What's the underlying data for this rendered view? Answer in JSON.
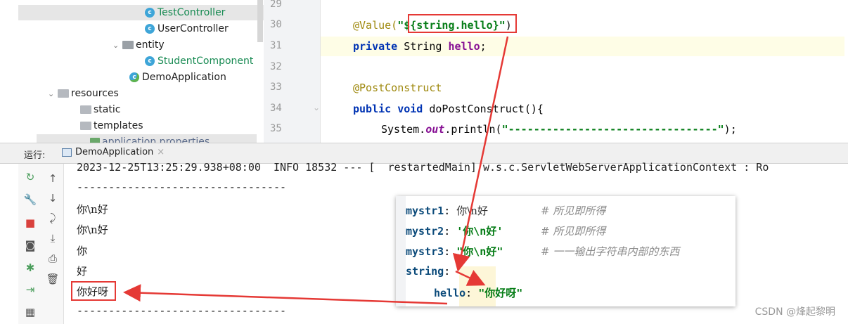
{
  "tree": {
    "items": [
      {
        "label": "TestController",
        "type": "class",
        "selected": true
      },
      {
        "label": "UserController",
        "type": "class"
      },
      {
        "label": "entity",
        "type": "package"
      },
      {
        "label": "StudentComponent",
        "type": "class"
      },
      {
        "label": "DemoApplication",
        "type": "run-class"
      },
      {
        "label": "resources",
        "type": "folder"
      },
      {
        "label": "static",
        "type": "folder"
      },
      {
        "label": "templates",
        "type": "folder"
      },
      {
        "label": "application.properties",
        "type": "file"
      }
    ]
  },
  "editor": {
    "line_numbers": [
      "29",
      "30",
      "31",
      "32",
      "33",
      "34",
      "35"
    ],
    "current_line": "31",
    "code": {
      "l30_annotation": "@Value(",
      "l30_string": "\"${string.hello}\"",
      "l30_close": ")",
      "l31_kw": "private",
      "l31_type": " String ",
      "l31_field": "hello",
      "l31_end": ";",
      "l33_annotation": "@PostConstruct",
      "l34_kw1": "public",
      "l34_kw2": " void",
      "l34_rest": " doPostConstruct(){",
      "l35_prefix": "System.",
      "l35_out": "out",
      "l35_call": ".println(",
      "l35_str": "\"---------------------------------\"",
      "l35_end": ");"
    }
  },
  "run_bar": {
    "label": "运行:",
    "tab": "DemoApplication",
    "close": "×"
  },
  "console": {
    "lines": [
      "2023-12-25T13:25:29.938+08:00  INFO 18532 --- [  restartedMain] w.s.c.ServletWebServerApplicationContext : Ro",
      "---------------------------------",
      "你\\n好",
      "你\\n好",
      "你",
      "好",
      "你好呀",
      "---------------------------------"
    ]
  },
  "yaml": {
    "rows": [
      {
        "key": "mystr1",
        "sep": ": ",
        "value": "你\\n好",
        "value_style": "plain",
        "comment": "# 所见即所得"
      },
      {
        "key": "mystr2",
        "sep": ": ",
        "value": "'你\\n好'",
        "value_style": "string",
        "comment": "# 所见即所得"
      },
      {
        "key": "mystr3",
        "sep": ": ",
        "value": "\"你\\n好\"",
        "value_style": "string",
        "comment": "# 一一输出字符串内部的东西"
      },
      {
        "key": "string",
        "sep": ":",
        "value": "",
        "value_style": "plain",
        "comment": ""
      },
      {
        "key": "hello",
        "sep": ": ",
        "value": "\"你好呀\"",
        "value_style": "string",
        "comment": "",
        "indent": true
      }
    ]
  },
  "watermark": "CSDN @烽起黎明",
  "colors": {
    "highlight_box": "#e53935",
    "arrow": "#e53935"
  }
}
